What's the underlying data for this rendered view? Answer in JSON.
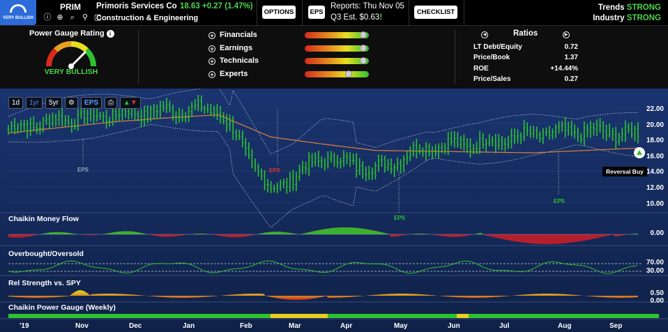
{
  "header": {
    "badge_label": "VERY BULLISH",
    "ticker": "PRIM",
    "company": "Primoris Services Co",
    "price": "18.63",
    "change": "+0.27",
    "change_pct": "(1.47%)",
    "sector": "Construction & Engineering",
    "options_label": "OPTIONS",
    "eps_label": "EPS",
    "reports_line": "Reports:  Thu Nov 05",
    "est_prefix": "Q3  Est.  $0.63",
    "est_arrow": "!",
    "checklist_label": "CHECKLIST",
    "trends_label": "Trends",
    "trends_value": "STRONG",
    "industry_label": "Industry",
    "industry_value": "STRONG",
    "icons": [
      "info-icon",
      "plus-icon",
      "search-icon",
      "link-icon",
      "document-icon"
    ]
  },
  "power_gauge": {
    "title": "Power Gauge Rating",
    "rating": "VERY BULLISH",
    "categories": [
      {
        "label": "Financials",
        "level": 0.92
      },
      {
        "label": "Earnings",
        "level": 0.92
      },
      {
        "label": "Technicals",
        "level": 0.92
      },
      {
        "label": "Experts",
        "level": 0.7
      }
    ]
  },
  "ratios": {
    "title": "Ratios",
    "rows": [
      {
        "label": "LT Debt/Equity",
        "value": "0.72"
      },
      {
        "label": "Price/Book",
        "value": "1.37"
      },
      {
        "label": "ROE",
        "value": "+14.44%"
      },
      {
        "label": "Price/Sales",
        "value": "0.27"
      }
    ]
  },
  "toolbar": {
    "buttons": [
      "1d",
      "1yr",
      "5yr",
      "⚙",
      "EPS",
      "⎙",
      "▲▼"
    ]
  },
  "chart": {
    "price_ticks": [
      "22.00",
      "20.00",
      "18.00",
      "16.00",
      "14.00",
      "12.00",
      "10.00"
    ],
    "cmf_label": "Chaikin Money Flow",
    "cmf_tick": "0.00",
    "obos_label": "Overbought/Oversold",
    "obos_ticks": [
      "70.00",
      "30.00"
    ],
    "rs_label": "Rel Strength vs. SPY",
    "rs_ticks": [
      "0.50",
      "0.00"
    ],
    "pgw_label": "Chaikin Power Gauge (Weekly)",
    "x_labels": [
      "'19",
      "Nov",
      "Dec",
      "Jan",
      "Feb",
      "Mar",
      "Apr",
      "May",
      "Jun",
      "Jul",
      "Aug",
      "Sep"
    ],
    "eps_events": [
      {
        "label": "EPS",
        "color": "#9aa4b4"
      },
      {
        "label": "EPS",
        "color": "#e03030"
      },
      {
        "label": "EPS",
        "color": "#2ec22e"
      },
      {
        "label": "EPS",
        "color": "#2ec22e"
      }
    ],
    "reversal_label": "Reversal Buy"
  },
  "chart_data": {
    "type": "line",
    "xlabel": "",
    "ylabel": "",
    "x": [
      "'19",
      "Nov",
      "Dec",
      "Jan",
      "Feb",
      "Mar",
      "Apr",
      "May",
      "Jun",
      "Jul",
      "Aug",
      "Sep"
    ],
    "ylim": [
      9,
      23
    ],
    "series": [
      {
        "values": [
          19.3,
          20.5,
          21.2,
          21.6,
          21.8,
          11.5,
          15.8,
          14.2,
          17.2,
          17.5,
          18.6,
          19.0,
          18.6
        ]
      },
      {
        "values": [
          18.8,
          19.5,
          20.2,
          20.7,
          21.1,
          18.3,
          17.4,
          16.6,
          16.5,
          16.4,
          16.3,
          16.6,
          16.9
        ]
      }
    ]
  }
}
